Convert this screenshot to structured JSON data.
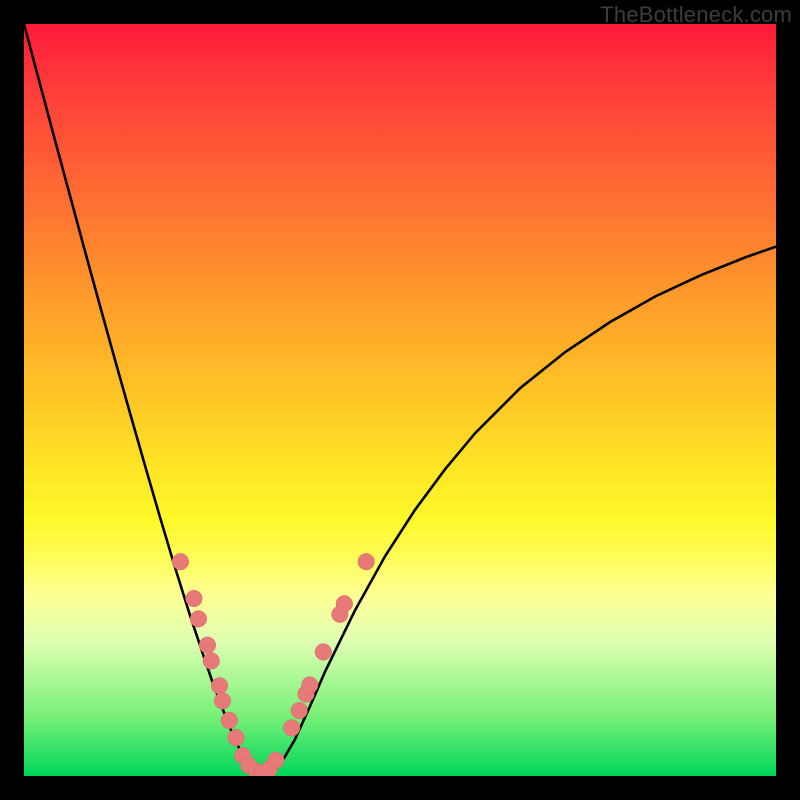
{
  "watermark": "TheBottleneck.com",
  "colors": {
    "frame": "#000000",
    "curve": "#000000",
    "marker_fill": "#e77a78",
    "marker_stroke": "#d46a68"
  },
  "chart_data": {
    "type": "line",
    "title": "",
    "xlabel": "",
    "ylabel": "",
    "xlim": [
      0,
      100
    ],
    "ylim": [
      0,
      100
    ],
    "x": [
      0,
      2,
      4,
      6,
      8,
      10,
      12,
      14,
      16,
      18,
      20,
      21,
      22,
      23,
      24,
      25,
      26,
      27,
      28,
      29,
      30,
      32,
      34,
      36,
      38,
      40,
      44,
      48,
      52,
      56,
      60,
      66,
      72,
      78,
      84,
      90,
      96,
      100
    ],
    "y": [
      100,
      92.5,
      85,
      77.6,
      70.2,
      62.9,
      55.7,
      48.6,
      41.6,
      34.7,
      28,
      24.8,
      21.6,
      18.6,
      15.6,
      12.7,
      10.0,
      7.4,
      5.0,
      2.9,
      1.2,
      0.05,
      1.4,
      4.8,
      9.2,
      13.8,
      22.0,
      29.2,
      35.4,
      40.8,
      45.6,
      51.6,
      56.4,
      60.4,
      63.8,
      66.6,
      69.0,
      70.4
    ],
    "series": [
      {
        "name": "bottleneck-curve",
        "color": "#000000"
      }
    ],
    "markers": {
      "name": "data-points",
      "color": "#e77a78",
      "radius_pct": 1.1,
      "points": [
        {
          "x": 20.8,
          "y": 28.5
        },
        {
          "x": 22.6,
          "y": 23.6
        },
        {
          "x": 23.2,
          "y": 20.9
        },
        {
          "x": 24.4,
          "y": 17.4
        },
        {
          "x": 24.9,
          "y": 15.3
        },
        {
          "x": 26.0,
          "y": 12.0
        },
        {
          "x": 26.4,
          "y": 10.0
        },
        {
          "x": 27.3,
          "y": 7.4
        },
        {
          "x": 28.2,
          "y": 5.1
        },
        {
          "x": 29.1,
          "y": 2.7
        },
        {
          "x": 29.9,
          "y": 1.4
        },
        {
          "x": 30.9,
          "y": 0.6
        },
        {
          "x": 31.7,
          "y": 0.4
        },
        {
          "x": 32.6,
          "y": 0.9
        },
        {
          "x": 33.5,
          "y": 2.1
        },
        {
          "x": 35.6,
          "y": 6.4
        },
        {
          "x": 36.6,
          "y": 8.7
        },
        {
          "x": 37.5,
          "y": 10.9
        },
        {
          "x": 38.0,
          "y": 12.1
        },
        {
          "x": 39.8,
          "y": 16.5
        },
        {
          "x": 42.0,
          "y": 21.5
        },
        {
          "x": 42.6,
          "y": 22.9
        },
        {
          "x": 45.5,
          "y": 28.5
        }
      ]
    }
  }
}
